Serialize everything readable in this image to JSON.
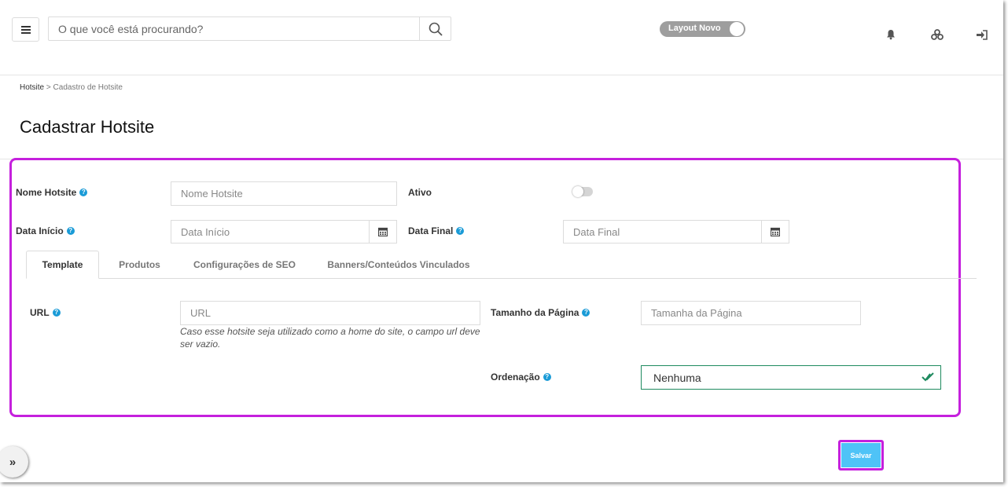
{
  "header": {
    "search_placeholder": "O que você está procurando?",
    "layout_toggle_label": "Layout Novo"
  },
  "breadcrumb": {
    "root": "Hotsite",
    "separator": ">",
    "current": "Cadastro de Hotsite"
  },
  "page_title": "Cadastrar Hotsite",
  "form": {
    "name_label": "Nome Hotsite",
    "name_placeholder": "Nome Hotsite",
    "active_label": "Ativo",
    "start_label": "Data Início",
    "start_placeholder": "Data Início",
    "end_label": "Data Final",
    "end_placeholder": "Data Final"
  },
  "tabs": [
    "Template",
    "Produtos",
    "Configurações de SEO",
    "Banners/Conteúdos Vinculados"
  ],
  "template": {
    "url_label": "URL",
    "url_placeholder": "URL",
    "url_hint": "Caso esse hotsite seja utilizado como a home do site, o campo url deve ser vazio.",
    "page_size_label": "Tamanho da Página",
    "page_size_placeholder": "Tamanha da Página",
    "order_label": "Ordenação",
    "order_value": "Nenhuma"
  },
  "actions": {
    "save_label": "Salvar"
  },
  "colors": {
    "highlight": "#c520dd",
    "help_icon": "#1a9bd7",
    "save_button": "#4fc3f7",
    "valid_border": "#1e8a5f"
  },
  "icons": [
    "hamburger-icon",
    "search-icon",
    "bell-icon",
    "cogs-icon",
    "sign-out-icon",
    "calendar-icon",
    "help-icon",
    "check-icon",
    "chevron-double-right-icon"
  ]
}
